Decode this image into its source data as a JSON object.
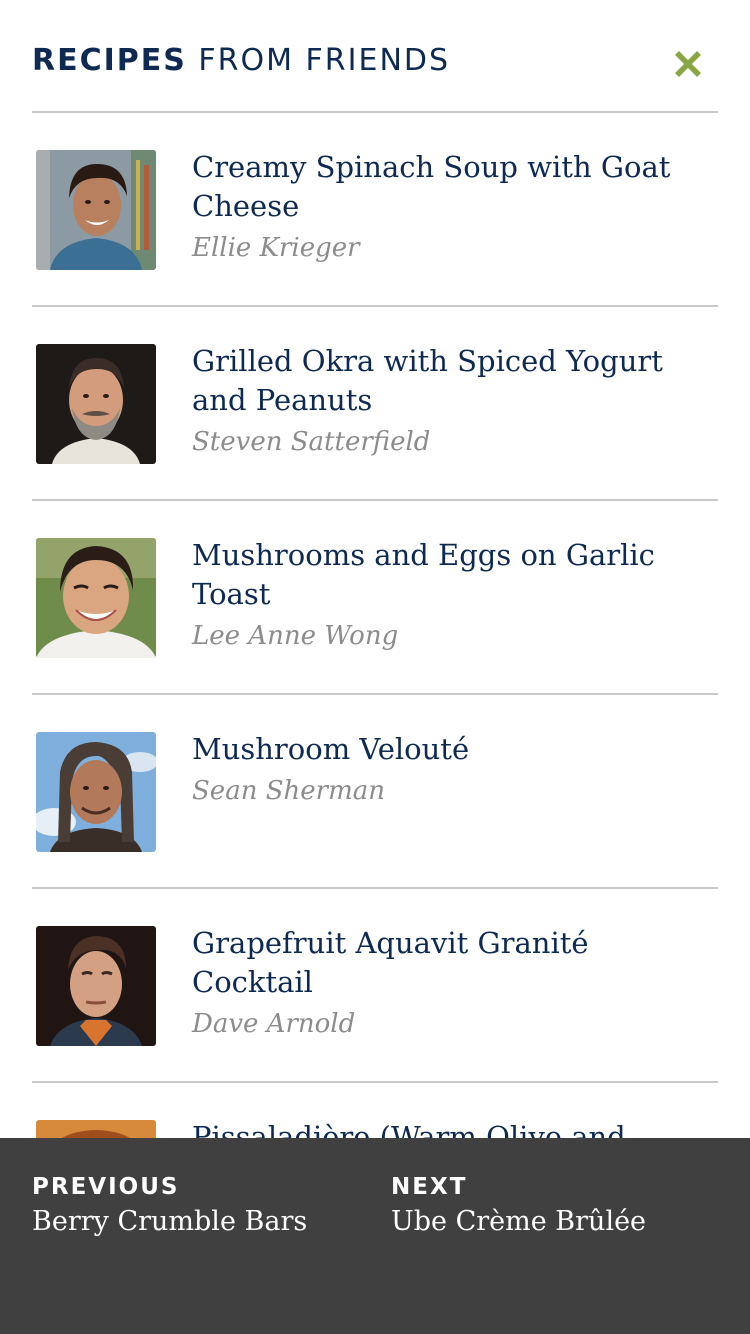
{
  "header": {
    "title_bold": "RECIPES",
    "title_rest": "FROM FRIENDS",
    "close_icon": "close-x-icon",
    "accent_color": "#8aa542"
  },
  "recipes": [
    {
      "title": "Creamy Spinach Soup with Goat Cheese",
      "author": "Ellie Krieger"
    },
    {
      "title": "Grilled Okra with Spiced Yogurt and Peanuts",
      "author": "Steven Satterfield"
    },
    {
      "title": "Mushrooms and Eggs on Garlic Toast",
      "author": "Lee Anne Wong"
    },
    {
      "title": "Mushroom Velouté",
      "author": "Sean Sherman"
    },
    {
      "title": "Grapefruit Aquavit Granité Cocktail",
      "author": "Dave Arnold"
    },
    {
      "title": "Pissaladière (Warm Olive and",
      "author": ""
    }
  ],
  "footer": {
    "previous_label": "PREVIOUS",
    "previous_title": "Berry Crumble Bars",
    "next_label": "NEXT",
    "next_title": "Ube Crème Brûlée",
    "background": "#404040"
  },
  "colors": {
    "title_navy": "#0e2a52",
    "author_gray": "#8c8c8c",
    "divider": "#c9c9c9"
  }
}
